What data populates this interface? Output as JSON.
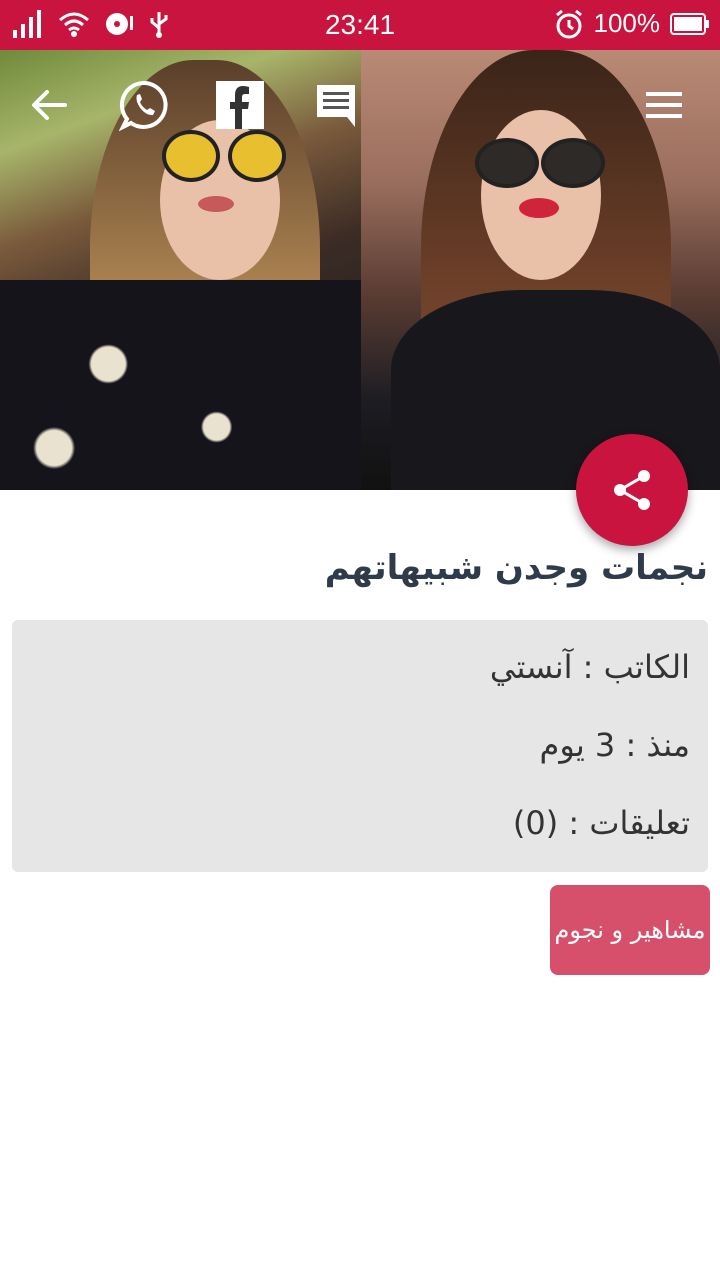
{
  "status_bar": {
    "time": "23:41",
    "battery": "100%",
    "color": "#c8143f"
  },
  "toolbar": {
    "icons": [
      "back-arrow-icon",
      "whatsapp-icon",
      "facebook-icon",
      "comments-icon",
      "menu-icon"
    ]
  },
  "article": {
    "title": "نجمات وجدن شبيهاتهم",
    "author_line": "الكاتب : آنستي",
    "date_line": "منذ : 3 يوم",
    "comments_line": "تعليقات : (0)"
  },
  "category": {
    "label": "مشاهير و نجوم",
    "color": "#d6506c"
  }
}
